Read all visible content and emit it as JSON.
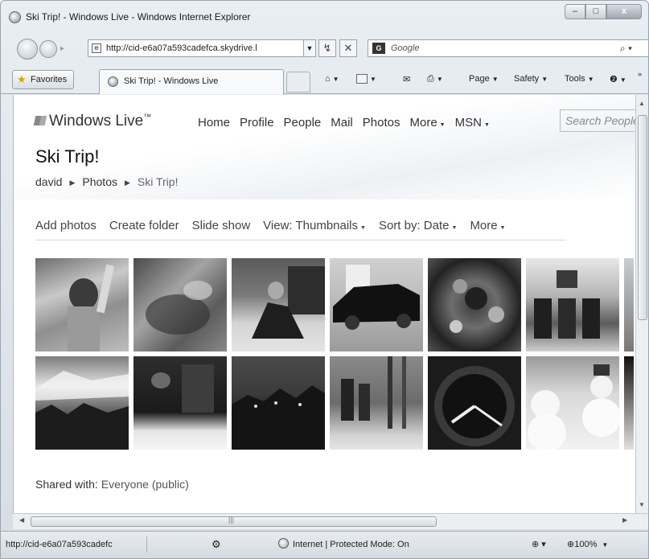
{
  "browser": {
    "title": "Ski Trip! - Windows Live - Windows Internet Explorer",
    "window_buttons": [
      "–",
      "□",
      "x"
    ],
    "address": "http://cid-e6a07a593cadefca.skydrive.l",
    "search_placeholder": "Google",
    "favorites_label": "Favorites",
    "tab_label": "Ski Trip! - Windows Live",
    "commands": {
      "page": "Page",
      "safety": "Safety",
      "tools": "Tools"
    }
  },
  "site": {
    "logo": "Windows Live",
    "nav": [
      "Home",
      "Profile",
      "People",
      "Mail",
      "Photos",
      "More",
      "MSN"
    ],
    "search_placeholder": "Search People",
    "page_title": "Ski Trip!",
    "breadcrumb": [
      "david",
      "Photos",
      "Ski Trip!"
    ],
    "toolbar": [
      "Add photos",
      "Create folder",
      "Slide show",
      "View: Thumbnails",
      "Sort by: Date",
      "More"
    ],
    "shared_label": "Shared with:",
    "shared_value": "Everyone (public)"
  },
  "photos": [
    {
      "name": "child-on-beach"
    },
    {
      "name": "garden-plants"
    },
    {
      "name": "person-sitting"
    },
    {
      "name": "black-limousine"
    },
    {
      "name": "flowers"
    },
    {
      "name": "kitchen-stools"
    },
    {
      "name": "mountain-forest"
    },
    {
      "name": "dark-room"
    },
    {
      "name": "town-at-night"
    },
    {
      "name": "skiers-in-woods"
    },
    {
      "name": "wristwatch"
    },
    {
      "name": "snowman"
    }
  ],
  "statusbar": {
    "url": "http://cid-e6a07a593cadefc",
    "zone": "Internet | Protected Mode: On",
    "zoom": "100%"
  }
}
